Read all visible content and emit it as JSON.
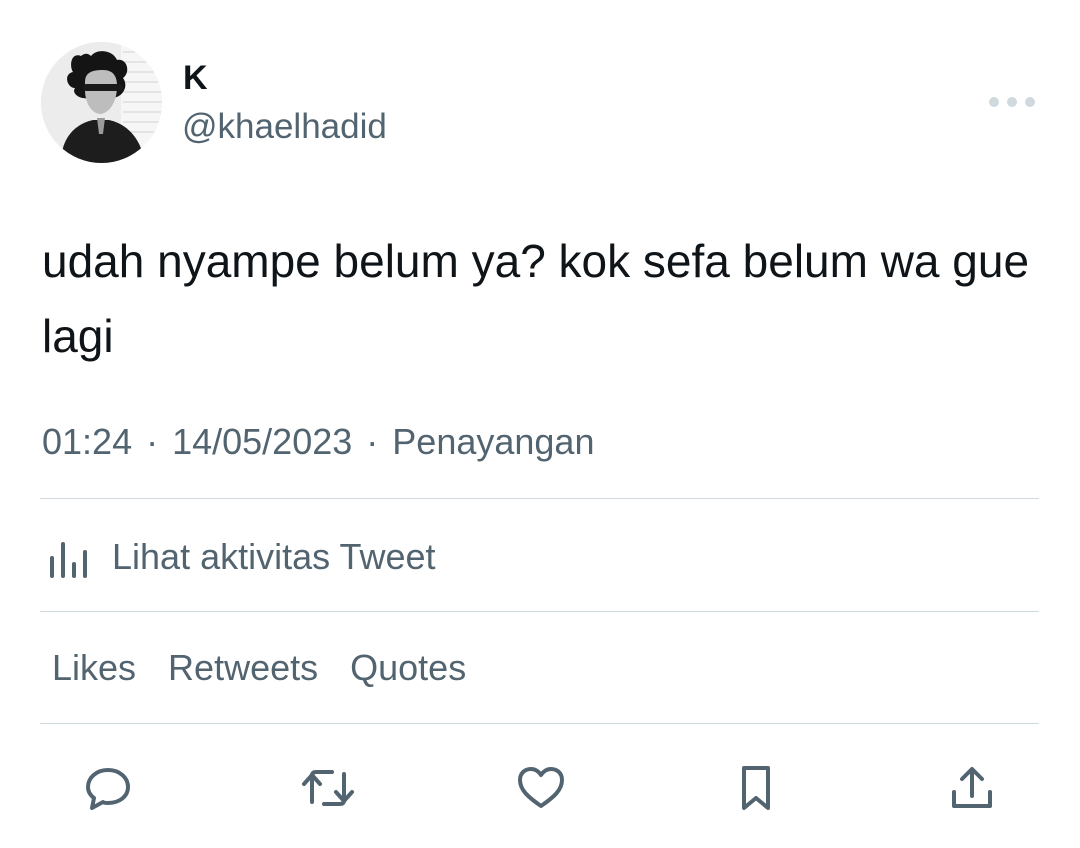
{
  "author": {
    "display_name": "K",
    "handle": "@khaelhadid"
  },
  "tweet": {
    "text": "udah nyampe belum ya? kok sefa belum wa gue lagi"
  },
  "meta": {
    "time": "01:24",
    "separator": "·",
    "date": "14/05/2023",
    "views_label": "Penayangan"
  },
  "activity": {
    "label": "Lihat aktivitas Tweet"
  },
  "stats": {
    "likes": "Likes",
    "retweets": "Retweets",
    "quotes": "Quotes"
  },
  "icons": {
    "more": "more-dots-icon",
    "analytics": "bar-chart-icon",
    "reply": "reply-icon",
    "retweet": "retweet-icon",
    "like": "heart-icon",
    "bookmark": "bookmark-icon",
    "share": "share-icon"
  },
  "colors": {
    "text_primary": "#0f1419",
    "text_secondary": "#536471",
    "divider": "#cfd9de"
  }
}
